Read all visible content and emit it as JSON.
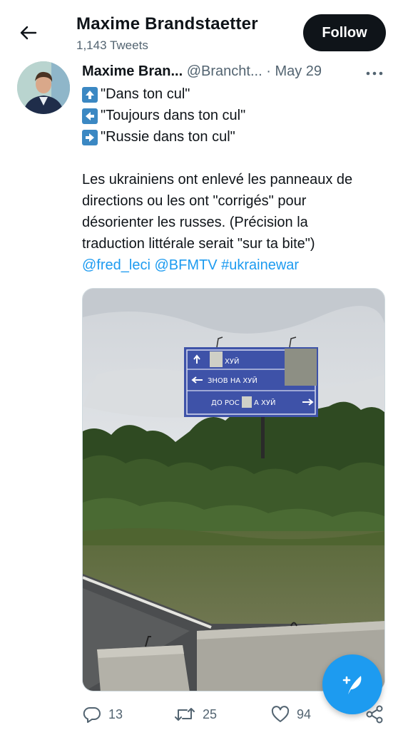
{
  "header": {
    "title": "Maxime Brandstaetter",
    "subtitle": "1,143 Tweets",
    "follow_label": "Follow"
  },
  "tweet": {
    "author_name": "Maxime Bran...",
    "handle": "@Brancht...",
    "separator": "·",
    "date": "May 29",
    "lines": [
      {
        "icon": "up-arrow-emoji-icon",
        "text": "\"Dans ton cul\""
      },
      {
        "icon": "left-arrow-emoji-icon",
        "text": "\"Toujours dans ton cul\""
      },
      {
        "icon": "right-arrow-emoji-icon",
        "text": "\"Russie dans ton cul\""
      }
    ],
    "body": [
      "Les ukrainiens ont enlevé les panneaux de",
      "directions ou les ont \"corrigés\" pour",
      "désorienter les russes. (Précision la",
      "traduction littérale serait \"sur ta bite\")"
    ],
    "mentions": [
      "@fred_leci",
      "@BFMTV",
      "#ukrainewar"
    ],
    "sign": {
      "line1": "ХУЙ",
      "line2": "ЗНОВ НА ХУЙ",
      "line3_a": "ДО РОС",
      "line3_b": "А ХУЙ"
    }
  },
  "actions": {
    "replies": "13",
    "retweets": "25",
    "likes": "94"
  },
  "colors": {
    "accent": "#1d9bf0",
    "text": "#0f1419",
    "muted": "#536471",
    "emoji_box": "#3b88c3"
  }
}
